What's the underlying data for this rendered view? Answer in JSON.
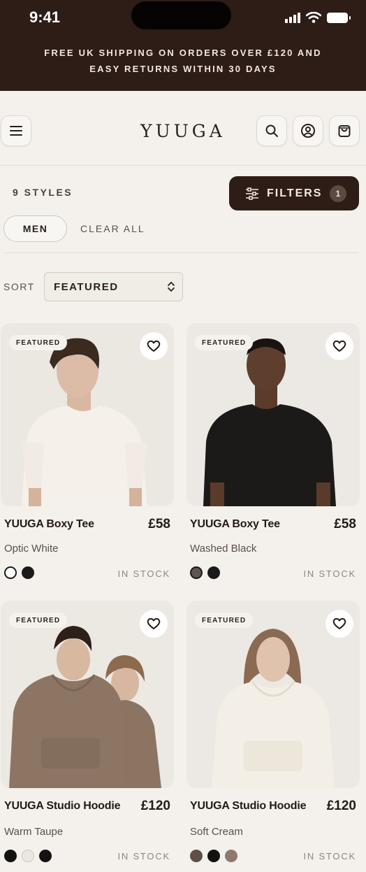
{
  "status_bar": {
    "time": "9:41"
  },
  "promo": {
    "line1": "FREE UK SHIPPING ON ORDERS OVER £120 AND",
    "line2": "EASY RETURNS WITHIN 30 DAYS"
  },
  "header": {
    "logo": "YUUGA",
    "icons": [
      "menu-icon",
      "search-icon",
      "account-icon",
      "bag-icon"
    ]
  },
  "toolbar": {
    "styles_count": "9 STYLES",
    "filters_label": "FILTERS",
    "filters_count": "1",
    "active_chip": "MEN",
    "clear_all": "CLEAR ALL",
    "sort_label": "SORT",
    "sort_value": "FEATURED"
  },
  "colors": {
    "brand_dark": "#2d1d16",
    "background": "#f4f1ec"
  },
  "products": [
    {
      "tag": "FEATURED",
      "name": "YUUGA Boxy Tee",
      "price": "£58",
      "color": "Optic White",
      "swatches": [
        "#ffffff",
        "#1b1a19"
      ],
      "stock": "IN STOCK"
    },
    {
      "tag": "FEATURED",
      "name": "YUUGA Boxy Tee",
      "price": "£58",
      "color": "Washed Black",
      "swatches": [
        "#5e5550",
        "#1b1a19"
      ],
      "stock": "IN STOCK"
    },
    {
      "tag": "FEATURED",
      "name": "YUUGA Studio Hoodie",
      "price": "£120",
      "color": "Warm Taupe",
      "swatches": [
        "#141211",
        "#ece7e0",
        "#141211"
      ],
      "stock": "IN STOCK"
    },
    {
      "tag": "FEATURED",
      "name": "YUUGA Studio Hoodie",
      "price": "£120",
      "color": "Soft Cream",
      "swatches": [
        "#5e5046",
        "#141211",
        "#8d7a6b"
      ],
      "stock": "IN STOCK"
    }
  ]
}
